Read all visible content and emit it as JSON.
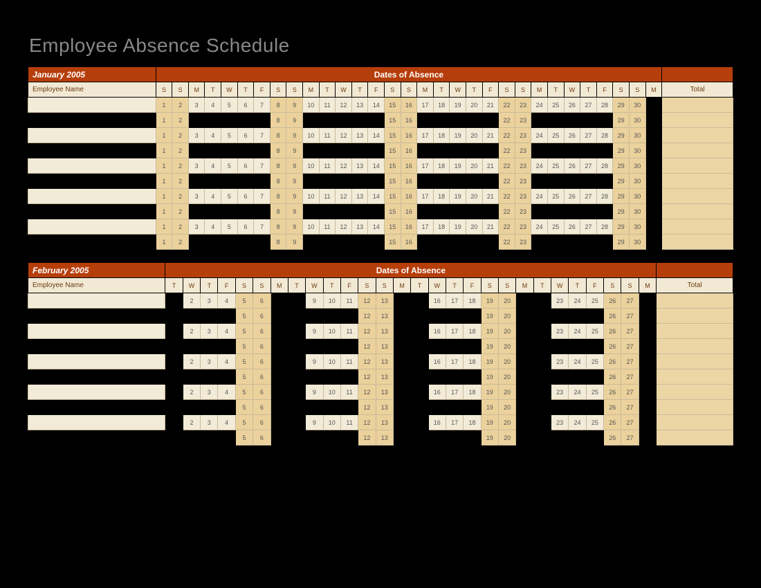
{
  "title": "Employee Absence Schedule",
  "emp_header": "Employee Name",
  "total_header": "Total",
  "doa_label": "Dates of Absence",
  "months": [
    {
      "name": "January 2005",
      "day_letters": [
        "S",
        "S",
        "M",
        "T",
        "W",
        "T",
        "F",
        "S",
        "S",
        "M",
        "T",
        "W",
        "T",
        "F",
        "S",
        "S",
        "M",
        "T",
        "W",
        "T",
        "F",
        "S",
        "S",
        "M",
        "T",
        "W",
        "T",
        "F",
        "S",
        "S",
        "M"
      ],
      "weekend_cols": [
        0,
        1,
        7,
        8,
        14,
        15,
        21,
        22,
        28,
        29
      ],
      "header_dark_cols": [
        30
      ],
      "totals": [
        "",
        "",
        "",
        "",
        "",
        "",
        "",
        "",
        "",
        ""
      ],
      "rows": [
        {
          "emp": "",
          "emp_dark": false,
          "dark_cols": [
            30
          ]
        },
        {
          "emp": "",
          "emp_dark": true,
          "dark_cols": [
            2,
            3,
            4,
            5,
            6,
            9,
            10,
            11,
            12,
            13,
            16,
            17,
            18,
            19,
            20,
            23,
            24,
            25,
            26,
            27,
            30
          ]
        },
        {
          "emp": "",
          "emp_dark": false,
          "dark_cols": [
            30
          ]
        },
        {
          "emp": "",
          "emp_dark": true,
          "dark_cols": [
            2,
            3,
            4,
            5,
            6,
            9,
            10,
            11,
            12,
            13,
            16,
            17,
            18,
            19,
            20,
            23,
            24,
            25,
            26,
            27,
            30
          ]
        },
        {
          "emp": "",
          "emp_dark": false,
          "dark_cols": [
            30
          ]
        },
        {
          "emp": "",
          "emp_dark": true,
          "dark_cols": [
            2,
            3,
            4,
            5,
            6,
            9,
            10,
            11,
            12,
            13,
            16,
            17,
            18,
            19,
            20,
            23,
            24,
            25,
            26,
            27,
            30
          ]
        },
        {
          "emp": "",
          "emp_dark": false,
          "dark_cols": [
            30
          ]
        },
        {
          "emp": "",
          "emp_dark": true,
          "dark_cols": [
            2,
            3,
            4,
            5,
            6,
            9,
            10,
            11,
            12,
            13,
            16,
            17,
            18,
            19,
            20,
            23,
            24,
            25,
            26,
            27,
            30
          ]
        },
        {
          "emp": "",
          "emp_dark": false,
          "dark_cols": [
            30
          ]
        },
        {
          "emp": "",
          "emp_dark": true,
          "dark_cols": [
            2,
            3,
            4,
            5,
            6,
            9,
            10,
            11,
            12,
            13,
            16,
            17,
            18,
            19,
            20,
            23,
            24,
            25,
            26,
            27,
            30
          ]
        }
      ]
    },
    {
      "name": "February 2005",
      "day_letters": [
        "T",
        "W",
        "T",
        "F",
        "S",
        "S",
        "M",
        "T",
        "W",
        "T",
        "F",
        "S",
        "S",
        "M",
        "T",
        "W",
        "T",
        "F",
        "S",
        "S",
        "M",
        "T",
        "W",
        "T",
        "F",
        "S",
        "S",
        "M"
      ],
      "weekend_cols": [
        4,
        5,
        11,
        12,
        18,
        19,
        25,
        26
      ],
      "header_dark_cols": [
        0,
        6,
        7,
        13,
        14,
        20,
        21,
        27
      ],
      "totals": [
        "",
        "",
        "",
        "",
        "",
        "",
        "",
        "",
        "",
        ""
      ],
      "rows": [
        {
          "emp": "",
          "emp_dark": false,
          "dark_cols": [
            0,
            6,
            7,
            13,
            14,
            20,
            21,
            27
          ]
        },
        {
          "emp": "",
          "emp_dark": true,
          "dark_cols": [
            0,
            1,
            2,
            3,
            6,
            7,
            8,
            9,
            10,
            13,
            14,
            15,
            16,
            17,
            20,
            21,
            22,
            23,
            24,
            27
          ]
        },
        {
          "emp": "",
          "emp_dark": false,
          "dark_cols": [
            0,
            6,
            7,
            13,
            14,
            20,
            21,
            27
          ]
        },
        {
          "emp": "",
          "emp_dark": true,
          "dark_cols": [
            0,
            1,
            2,
            3,
            6,
            7,
            8,
            9,
            10,
            13,
            14,
            15,
            16,
            17,
            20,
            21,
            22,
            23,
            24,
            27
          ]
        },
        {
          "emp": "",
          "emp_dark": false,
          "dark_cols": [
            0,
            6,
            7,
            13,
            14,
            20,
            21,
            27
          ]
        },
        {
          "emp": "",
          "emp_dark": true,
          "dark_cols": [
            0,
            1,
            2,
            3,
            6,
            7,
            8,
            9,
            10,
            13,
            14,
            15,
            16,
            17,
            20,
            21,
            22,
            23,
            24,
            27
          ]
        },
        {
          "emp": "",
          "emp_dark": false,
          "dark_cols": [
            0,
            6,
            7,
            13,
            14,
            20,
            21,
            27
          ]
        },
        {
          "emp": "",
          "emp_dark": true,
          "dark_cols": [
            0,
            1,
            2,
            3,
            6,
            7,
            8,
            9,
            10,
            13,
            14,
            15,
            16,
            17,
            20,
            21,
            22,
            23,
            24,
            27
          ]
        },
        {
          "emp": "",
          "emp_dark": false,
          "dark_cols": [
            0,
            6,
            7,
            13,
            14,
            20,
            21,
            27
          ]
        },
        {
          "emp": "",
          "emp_dark": true,
          "dark_cols": [
            0,
            1,
            2,
            3,
            6,
            7,
            8,
            9,
            10,
            13,
            14,
            15,
            16,
            17,
            20,
            21,
            22,
            23,
            24,
            27
          ]
        }
      ]
    }
  ]
}
